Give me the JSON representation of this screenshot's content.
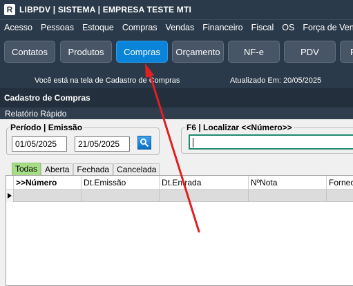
{
  "app": {
    "logo_letter": "R",
    "title": "LIBPDV | SISTEMA | EMPRESA TESTE MTI"
  },
  "menu": [
    "Acesso",
    "Pessoas",
    "Estoque",
    "Compras",
    "Vendas",
    "Financeiro",
    "Fiscal",
    "OS",
    "Força de Venda"
  ],
  "toolbar": {
    "buttons": [
      "Contatos",
      "Produtos",
      "Compras",
      "Orçamento",
      "NF-e",
      "PDV",
      "R"
    ],
    "active": "Compras",
    "status_text": "Você está na tela de Cadastro de Compras",
    "updated_text": "Atualizado Em: 20/05/2025"
  },
  "window": {
    "title": "Cadastro de Compras",
    "menu_label": "Relatório Rápido"
  },
  "period": {
    "label": "Período | Emissão",
    "start": "01/05/2025",
    "end": "21/05/2025"
  },
  "locate": {
    "label": "F6 | Localizar <<Número>>",
    "value": ""
  },
  "tabs": [
    "Todas",
    "Aberta",
    "Fechada",
    "Cancelada"
  ],
  "active_tab": "Todas",
  "grid": {
    "columns": [
      ">>Número",
      "Dt.Emissão",
      "Dt.Entrada",
      "NºNota",
      "Fornec"
    ],
    "rows": [
      [
        "",
        "",
        "",
        "",
        ""
      ]
    ]
  },
  "colors": {
    "titlebar": "#2b3a4a",
    "active_button": "#0a84d8",
    "active_tab": "#a6dd86",
    "arrow": "#e02020"
  },
  "icons": {
    "search_button": "magnifier-icon",
    "row_pointer": "triangle-right-icon"
  }
}
